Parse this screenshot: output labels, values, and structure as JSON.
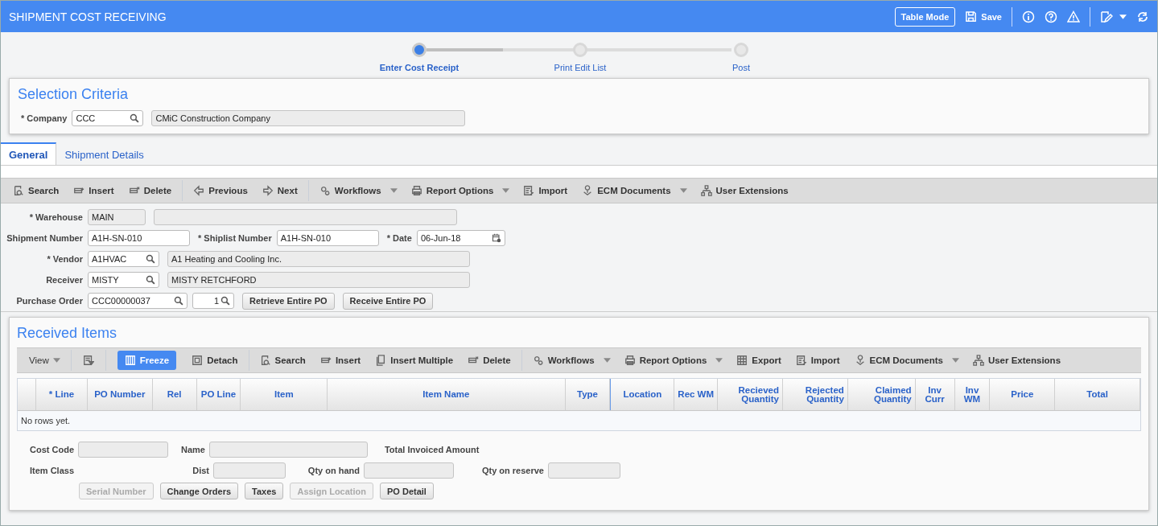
{
  "header": {
    "title": "SHIPMENT COST RECEIVING",
    "table_mode": "Table Mode",
    "save": "Save"
  },
  "train": {
    "level": 0.25,
    "steps": [
      {
        "label": "Enter Cost Receipt",
        "selected": true
      },
      {
        "label": "Print Edit List",
        "selected": false
      },
      {
        "label": "Post",
        "selected": false
      }
    ]
  },
  "selection_criteria": {
    "title": "Selection Criteria",
    "company": {
      "label": "* Company",
      "value": "CCC",
      "description": "CMiC Construction Company"
    }
  },
  "tabs": [
    {
      "label": "General",
      "selected": true
    },
    {
      "label": "Shipment Details",
      "selected": false
    }
  ],
  "toolbar": {
    "groups": [
      [
        {
          "kind": "search",
          "label": "Search"
        },
        {
          "kind": "insert",
          "label": "Insert"
        },
        {
          "kind": "delete",
          "label": "Delete"
        }
      ],
      [
        {
          "kind": "previous",
          "label": "Previous"
        },
        {
          "kind": "next",
          "label": "Next"
        }
      ],
      [
        {
          "kind": "workflows",
          "label": "Workflows",
          "dropdown": true
        },
        {
          "kind": "report",
          "label": "Report Options",
          "dropdown": true
        },
        {
          "kind": "import",
          "label": "Import"
        },
        {
          "kind": "ecm",
          "label": "ECM Documents",
          "dropdown": true
        },
        {
          "kind": "extensions",
          "label": "User Extensions"
        }
      ]
    ]
  },
  "form_rows": [
    [
      {
        "label": "* Warehouse",
        "kind": "readonly",
        "value": "MAIN"
      },
      {
        "kind": "description"
      }
    ],
    [
      {
        "label": "Shipment Number",
        "kind": "text",
        "value": "A1H-SN-010"
      },
      {
        "label": "* Shiplist Number",
        "kind": "text",
        "value": "A1H-SN-010"
      },
      {
        "label": "* Date",
        "kind": "date",
        "value": "06-Jun-18"
      }
    ],
    [
      {
        "label": "* Vendor",
        "kind": "lookup",
        "value": "A1HVAC"
      },
      {
        "kind": "description",
        "value": "A1 Heating and Cooling Inc."
      }
    ],
    [
      {
        "label": "Receiver",
        "kind": "lookup",
        "value": "MISTY"
      },
      {
        "kind": "description",
        "value": "MISTY RETCHFORD"
      }
    ],
    [
      {
        "label": "Purchase Order",
        "kind": "lookup_wide",
        "value": "CCC00000037"
      },
      {
        "kind": "spin",
        "value": "1"
      },
      {
        "kind": "button",
        "value": "Retrieve Entire PO"
      },
      {
        "kind": "button",
        "value": "Receive Entire PO"
      }
    ]
  ],
  "received_items": {
    "title": "Received Items",
    "toolbar": {
      "view": "View",
      "groups": [
        [
          {
            "kind": "query"
          }
        ],
        [
          {
            "kind": "freeze",
            "label": "Freeze",
            "selected": true
          },
          {
            "kind": "detach",
            "label": "Detach",
            "selected": false
          }
        ],
        [
          {
            "kind": "search",
            "label": "Search"
          },
          {
            "kind": "insert",
            "label": "Insert"
          },
          {
            "kind": "insert_multiple",
            "label": "Insert Multiple"
          },
          {
            "kind": "delete",
            "label": "Delete"
          }
        ],
        [
          {
            "kind": "workflows",
            "label": "Workflows",
            "dropdown": true
          },
          {
            "kind": "report",
            "label": "Report Options",
            "dropdown": true
          },
          {
            "kind": "export",
            "label": "Export"
          },
          {
            "kind": "import",
            "label": "Import"
          },
          {
            "kind": "ecm",
            "label": "ECM Documents",
            "dropdown": true
          },
          {
            "kind": "extensions",
            "label": "User Extensions"
          }
        ]
      ]
    },
    "columns": [
      "* Line",
      "PO Number",
      "Rel",
      "PO Line",
      "Item",
      "Item Name",
      "Type",
      "Location",
      "Rec WM",
      "Recieved Quantity",
      "Rejected Quantity",
      "Claimed Quantity",
      "Inv Curr",
      "Inv WM",
      "Price",
      "Total"
    ],
    "empty_text": "No rows yet.",
    "detail_rows": [
      [
        {
          "label": "Cost Code",
          "kind": "field"
        },
        {
          "label": "Name",
          "kind": "wide_field"
        },
        {
          "label": "Total Invoiced Amount",
          "kind": "label_only"
        }
      ],
      [
        {
          "label": "Item Class",
          "kind": "label_only"
        },
        {
          "label": "Dist",
          "kind": "field"
        },
        {
          "label": "Qty on hand",
          "kind": "field"
        },
        {
          "label": "Qty on reserve",
          "kind": "field"
        }
      ]
    ],
    "buttons": [
      {
        "label": "Serial Number",
        "disabled": true
      },
      {
        "label": "Change Orders",
        "disabled": false
      },
      {
        "label": "Taxes",
        "disabled": false
      },
      {
        "label": "Assign Location",
        "disabled": true
      },
      {
        "label": "PO Detail",
        "disabled": false
      }
    ]
  }
}
